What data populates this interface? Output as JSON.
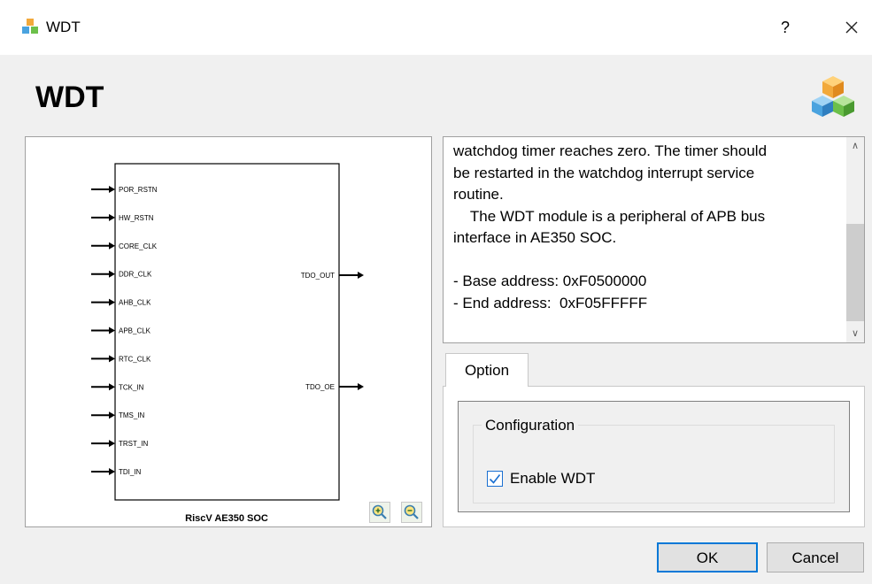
{
  "window": {
    "title": "WDT",
    "help_label": "?",
    "close_icon": "close-icon",
    "app_icon": "cubes-icon"
  },
  "header": {
    "title": "WDT",
    "brand_icon": "cubes-icon"
  },
  "diagram": {
    "caption": "RiscV AE350 SOC",
    "inputs": [
      "POR_RSTN",
      "HW_RSTN",
      "CORE_CLK",
      "DDR_CLK",
      "AHB_CLK",
      "APB_CLK",
      "RTC_CLK",
      "TCK_IN",
      "TMS_IN",
      "TRST_IN",
      "TDI_IN"
    ],
    "outputs": [
      "TDO_OUT",
      "TDO_OE"
    ],
    "zoom_in_icon": "zoom-in-icon",
    "zoom_out_icon": "zoom-out-icon"
  },
  "description": {
    "text": "watchdog timer reaches zero. The timer should\nbe restarted in the watchdog interrupt service\nroutine.\n    The WDT module is a peripheral of APB bus\ninterface in AE350 SOC.\n\n- Base address: 0xF0500000\n- End address:  0xF05FFFFF"
  },
  "tabs": [
    {
      "label": "Option",
      "selected": true
    }
  ],
  "option": {
    "group_label": "Configuration",
    "enable_label": "Enable WDT",
    "enable_checked": true
  },
  "buttons": {
    "ok": "OK",
    "cancel": "Cancel"
  },
  "colors": {
    "accent": "#0078d7",
    "checkbox": "#1a6fd1"
  }
}
